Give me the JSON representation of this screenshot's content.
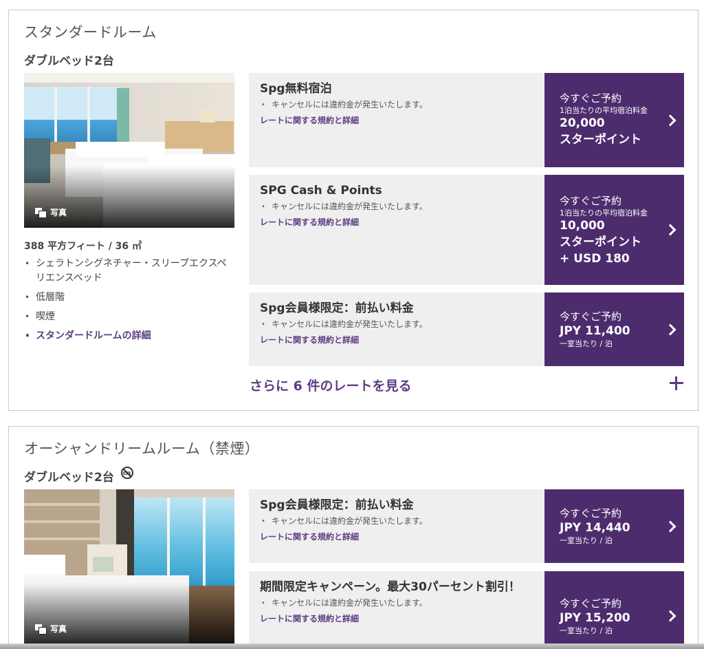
{
  "rooms": [
    {
      "title": "スタンダードルーム",
      "bed": "ダブルベッド2台",
      "photo_label": "写真",
      "size": "388 平方フィート / 36 ㎡",
      "amenities": [
        "シェラトンシグネチャー・スリープエクスペリエンスベッド",
        "低層階",
        "喫煙"
      ],
      "details_link": "スタンダードルームの詳細",
      "rates": [
        {
          "name": "Spg無料宿泊",
          "policy": "キャンセルには違約金が発生いたします。",
          "rules_link": "レートに関する規約と詳細",
          "book_label": "今すぐご予約",
          "price_note": "1泊当たりの平均宿泊料金",
          "price_line1": "20,000",
          "price_line2": "スターポイント",
          "price_line3": ""
        },
        {
          "name": "SPG Cash & Points",
          "policy": "キャンセルには違約金が発生いたします。",
          "rules_link": "レートに関する規約と詳細",
          "book_label": "今すぐご予約",
          "price_note": "1泊当たりの平均宿泊料金",
          "price_line1": "10,000",
          "price_line2": "スターポイント",
          "price_line3": "+ USD 180"
        },
        {
          "name": "Spg会員様限定：前払い料金",
          "policy": "キャンセルには違約金が発生いたします。",
          "rules_link": "レートに関する規約と詳細",
          "book_label": "今すぐご予約",
          "price": "JPY 11,400",
          "price_unit": "一室当たり / 泊"
        }
      ],
      "more_rates": "さらに 6 件のレートを見る"
    },
    {
      "title": "オーシャンドリームルーム（禁煙）",
      "bed": "ダブルベッド2台",
      "photo_label": "写真",
      "rates": [
        {
          "name": "Spg会員様限定：前払い料金",
          "policy": "キャンセルには違約金が発生いたします。",
          "rules_link": "レートに関する規約と詳細",
          "book_label": "今すぐご予約",
          "price": "JPY 14,440",
          "price_unit": "一室当たり / 泊"
        },
        {
          "name": "期間限定キャンペーン。最大30パーセント割引！",
          "policy": "キャンセルには違約金が発生いたします。",
          "rules_link": "レートに関する規約と詳細",
          "book_label": "今すぐご予約",
          "price": "JPY 15,200",
          "price_unit": "一室当たり / 泊"
        }
      ]
    }
  ],
  "icons": {
    "photo": "photo-stack-icon",
    "no_smoking": "no-smoking-icon",
    "chevron": "chevron-right-icon",
    "expand": "plus-icon"
  },
  "colors": {
    "accent": "#4d2c6e",
    "link": "#5b3d82",
    "rate_bg": "#efefef"
  }
}
